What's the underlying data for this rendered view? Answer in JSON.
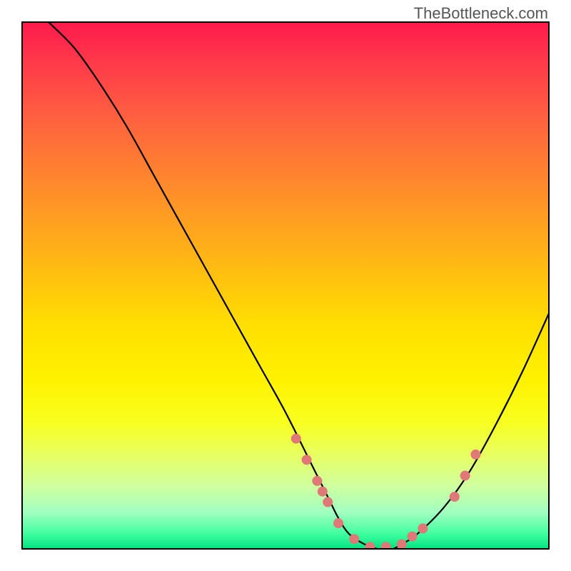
{
  "watermark": "TheBottleneck.com",
  "chart_data": {
    "type": "line",
    "title": "",
    "xlabel": "",
    "ylabel": "",
    "xlim": [
      0,
      100
    ],
    "ylim": [
      0,
      100
    ],
    "grid": false,
    "series": [
      {
        "name": "bottleneck-curve",
        "x": [
          5,
          10,
          15,
          20,
          25,
          30,
          35,
          40,
          45,
          50,
          55,
          58,
          60,
          62,
          65,
          68,
          70,
          72,
          75,
          80,
          85,
          90,
          95,
          100
        ],
        "y": [
          100,
          95,
          88,
          80,
          71,
          62,
          53,
          44,
          35,
          26,
          16,
          10,
          6,
          3,
          1,
          0,
          0,
          1,
          3,
          8,
          15,
          24,
          34,
          45
        ]
      }
    ],
    "scatter_points": {
      "name": "markers",
      "x": [
        52,
        54,
        56,
        57,
        58,
        60,
        63,
        66,
        69,
        72,
        74,
        76,
        82,
        84,
        86
      ],
      "y": [
        21,
        17,
        13,
        11,
        9,
        5,
        2,
        0.5,
        0.5,
        1,
        2.5,
        4,
        10,
        14,
        18
      ]
    },
    "gradient": {
      "top": "#ff1a4d",
      "bottom": "#00e080"
    }
  }
}
